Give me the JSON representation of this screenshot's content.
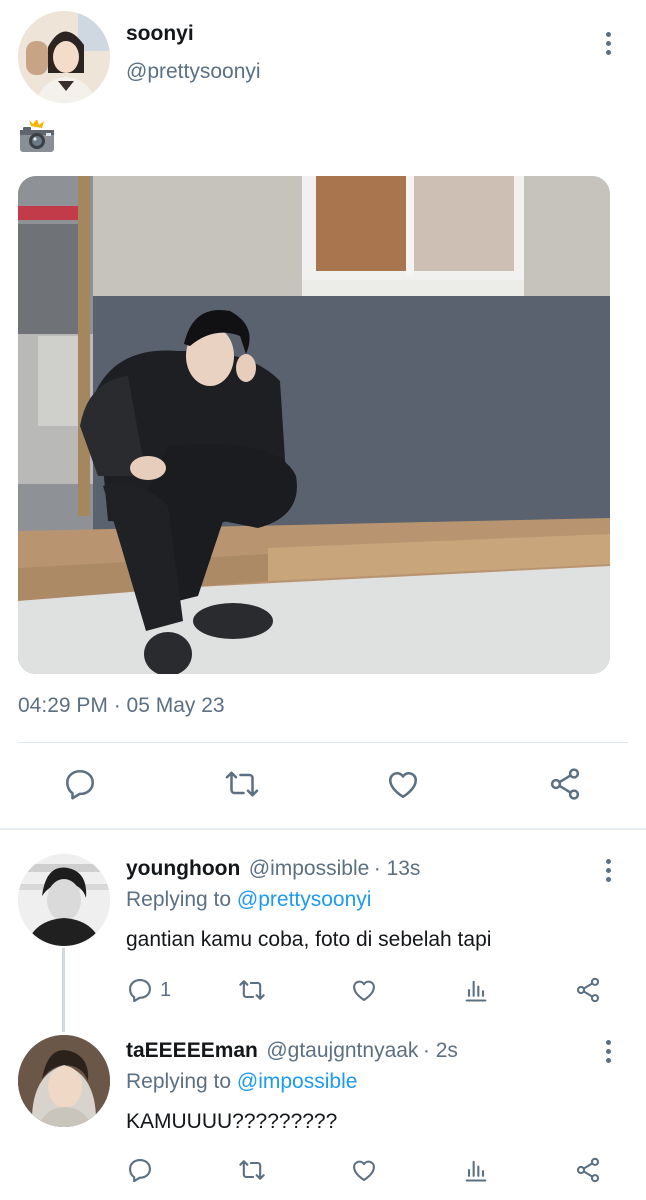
{
  "tweet": {
    "display_name": "soonyi",
    "handle": "@prettysoonyi",
    "text_icon": "camera-emoji-icon",
    "timestamp": "04:29 PM · 05 May 23",
    "actions": [
      "reply-icon",
      "retweet-icon",
      "like-icon",
      "share-icon"
    ]
  },
  "replies": [
    {
      "display_name": "younghoon",
      "handle": "@impossible",
      "time": "· 13s",
      "replying_prefix": "Replying to",
      "replying_to": "@prettysoonyi",
      "text": "gantian kamu coba, foto di sebelah tapi",
      "reply_count": "1"
    },
    {
      "display_name": "taEEEEEman",
      "handle": "@gtaujgntnyaak",
      "time": "· 2s",
      "replying_prefix": "Replying to",
      "replying_to": "@impossible",
      "text": "KAMUUUU?????????",
      "reply_count": ""
    }
  ],
  "colors": {
    "accent": "#1d9bf0",
    "secondary_text": "#5b7083",
    "divider": "#e1e8ed"
  }
}
